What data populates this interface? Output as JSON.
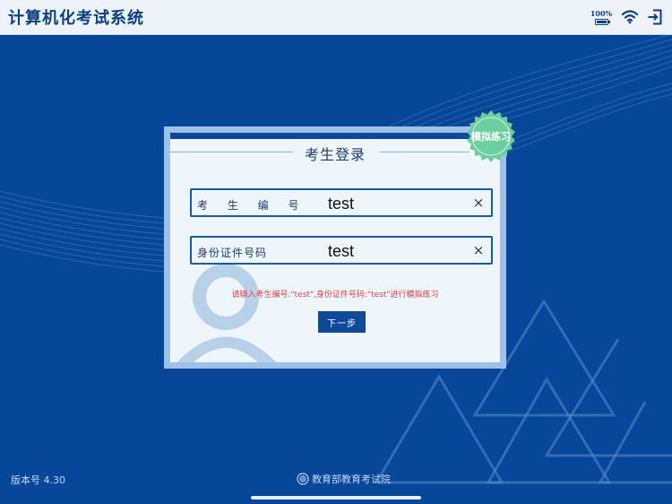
{
  "header": {
    "title": "计算机化考试系统",
    "battery_text": "100%",
    "battery_level": 1.0
  },
  "login_card": {
    "title": "考生登录",
    "badge": "模拟练习",
    "fields": [
      {
        "label": "考 生 编 号",
        "value": "test"
      },
      {
        "label": "身份证件号码",
        "value": "test"
      }
    ],
    "clear_symbol": "×",
    "hint": "请输入考生编号:\"test\",身份证件号码:\"test\"进行模拟练习",
    "next_button": "下一步"
  },
  "footer": {
    "version": "版本号 4.30",
    "organization": "教育部教育考试院"
  },
  "colors": {
    "background": "#07479a",
    "header_bg": "#eef3fa",
    "badge": "#6ccf9f",
    "hint": "#e0424a",
    "button": "#0d4a9a"
  },
  "icons": [
    "wifi-icon",
    "exit-icon",
    "battery-icon",
    "seal-icon",
    "user-silhouette-icon"
  ]
}
